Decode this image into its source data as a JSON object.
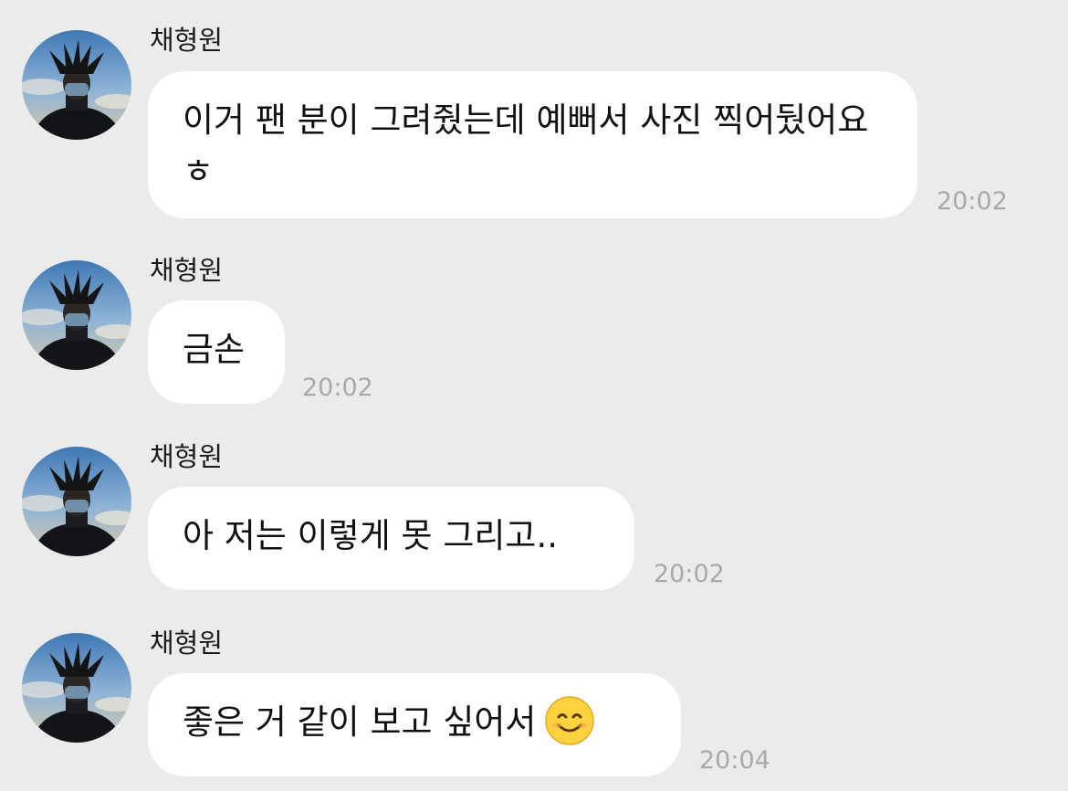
{
  "colors": {
    "background": "#ebebeb",
    "bubble": "#ffffff",
    "timestamp": "#a9a9a9"
  },
  "messages": [
    {
      "sender": "채형원",
      "text": "이거 팬 분이 그려줬는데 예뻐서 사진 찍어뒀어요 ㅎ",
      "time": "20:02",
      "avatar_icon": "profile-photo"
    },
    {
      "sender": "채형원",
      "text": "금손",
      "time": "20:02",
      "avatar_icon": "profile-photo"
    },
    {
      "sender": "채형원",
      "text": "아 저는 이렇게 못 그리고..",
      "time": "20:02",
      "avatar_icon": "profile-photo"
    },
    {
      "sender": "채형원",
      "text": "좋은 거 같이 보고 싶어서",
      "emoji": "smiling-face-emoji",
      "time": "20:04",
      "avatar_icon": "profile-photo"
    }
  ]
}
